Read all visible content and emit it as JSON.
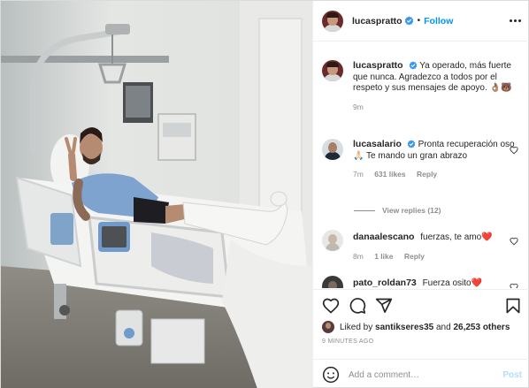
{
  "post": {
    "author": "lucaspratto",
    "follow_label": "Follow",
    "separator": "•"
  },
  "caption": {
    "user": "lucaspratto",
    "text": "Ya operado, más fuerte que nunca. Agradezco a todos por el respeto y sus mensajes de apoyo. 👌🏽🐻",
    "time": "9m"
  },
  "comments": [
    {
      "user": "lucasalario",
      "text": "Pronta recuperación oso 🙏🏻 Te mando un gran abrazo",
      "time": "7m",
      "likes": "631 likes",
      "reply_label": "Reply"
    },
    {
      "user": "danaalescano",
      "text": "fuerzas, te amo❤️",
      "time": "8m",
      "likes": "1 like",
      "reply_label": "Reply"
    },
    {
      "user": "pato_roldan73",
      "text": "Fuerza osito❤️",
      "time": "",
      "likes": "",
      "reply_label": ""
    }
  ],
  "view_replies": "View replies (12)",
  "liked_by": {
    "prefix": "Liked by",
    "user": "santikseres35",
    "and": "and",
    "count": "26,253 others"
  },
  "timestamp": "9 MINUTES AGO",
  "add_comment": {
    "placeholder": "Add a comment…",
    "post_label": "Post"
  },
  "colors": {
    "accent": "#0095f6",
    "heart": "#ed4956",
    "muted": "#8e8e8e"
  },
  "icons": [
    "verified-badge-icon",
    "more-options-icon",
    "heart-icon",
    "comment-icon",
    "share-icon",
    "bookmark-icon",
    "emoji-icon"
  ]
}
